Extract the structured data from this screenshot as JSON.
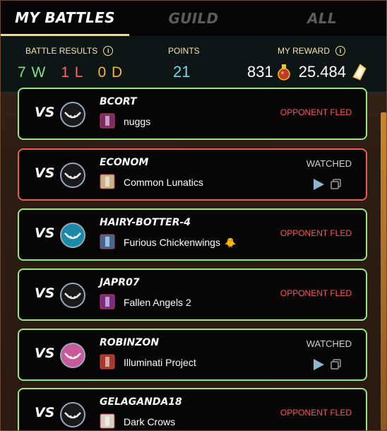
{
  "tabs": [
    {
      "label": "MY BATTLES"
    },
    {
      "label": "GUILD"
    },
    {
      "label": "ALL"
    }
  ],
  "summary": {
    "battle_results_label": "BATTLE RESULTS",
    "wins": "7 W",
    "losses": "1 L",
    "draws": "0 D",
    "points_label": "POINTS",
    "points": "21",
    "reward_label": "MY REWARD",
    "reward_potions": "831",
    "reward_dec": "25.484",
    "colors": {
      "win": "#7ee28e",
      "loss": "#ff6666",
      "draw": "#f1b341",
      "points": "#6fd6ea"
    }
  },
  "battles": [
    {
      "vs": "VS",
      "opponent": "BCORT",
      "guild": "nuggs",
      "status": "OPPONENT FLED",
      "result": "win",
      "avatar": "monster-avatar-icon",
      "guild_icon": "purple-banner-icon"
    },
    {
      "vs": "VS",
      "opponent": "ECONOM",
      "guild": "Common Lunatics",
      "status": "WATCHED",
      "result": "loss",
      "avatar": "monster-avatar-icon",
      "guild_icon": "sword-banner-icon"
    },
    {
      "vs": "VS",
      "opponent": "HAIRY-BOTTER-4",
      "guild": "Furious Chickenwings",
      "guild_suffix": "🐥",
      "status": "OPPONENT FLED",
      "result": "win",
      "avatar": "creature-avatar-icon",
      "guild_icon": "wing-banner-icon"
    },
    {
      "vs": "VS",
      "opponent": "JAPR07",
      "guild": "Fallen Angels 2",
      "status": "OPPONENT FLED",
      "result": "win",
      "avatar": "monster-avatar-icon",
      "guild_icon": "lightning-banner-icon"
    },
    {
      "vs": "VS",
      "opponent": "ROBINZON",
      "guild": "Illuminati Project",
      "status": "WATCHED",
      "result": "win",
      "avatar": "goblin-avatar-icon",
      "guild_icon": "tree-banner-icon"
    },
    {
      "vs": "VS",
      "opponent": "GELAGANDA18",
      "guild": "Dark Crows",
      "status": "OPPONENT FLED",
      "result": "win",
      "avatar": "monster-avatar-icon",
      "guild_icon": "crow-banner-icon"
    }
  ]
}
